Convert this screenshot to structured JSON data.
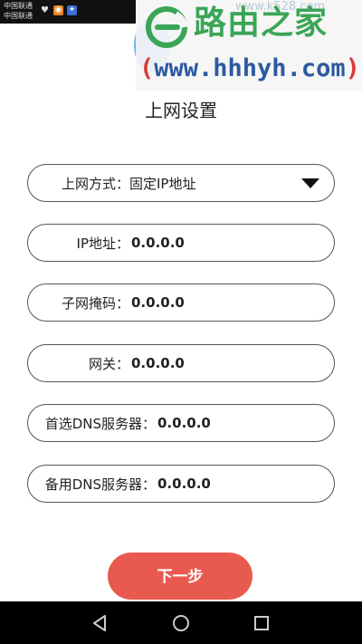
{
  "status_bar": {
    "carrier_1": "中国联通",
    "carrier_2": "中国联通"
  },
  "watermark": {
    "site_name": "路由之家",
    "url": "www.hhhyh.com",
    "paren_open": "(",
    "paren_close": ")",
    "faint_text": "www.k528.com"
  },
  "page": {
    "title": "上网设置"
  },
  "form": {
    "connection_type": {
      "label": "上网方式：",
      "value": "固定IP地址"
    },
    "ip_address": {
      "label": "IP地址：",
      "value": "0.0.0.0"
    },
    "subnet_mask": {
      "label": "子网掩码：",
      "value": "0.0.0.0"
    },
    "gateway": {
      "label": "网关：",
      "value": "0.0.0.0"
    },
    "primary_dns": {
      "label": "首选DNS服务器：",
      "value": "0.0.0.0"
    },
    "secondary_dns": {
      "label": "备用DNS服务器：",
      "value": "0.0.0.0"
    }
  },
  "actions": {
    "next_label": "下一步"
  },
  "colors": {
    "accent": "#e85a4f",
    "watermark_green": "#3aa556",
    "watermark_blue": "#2c5aa0"
  }
}
